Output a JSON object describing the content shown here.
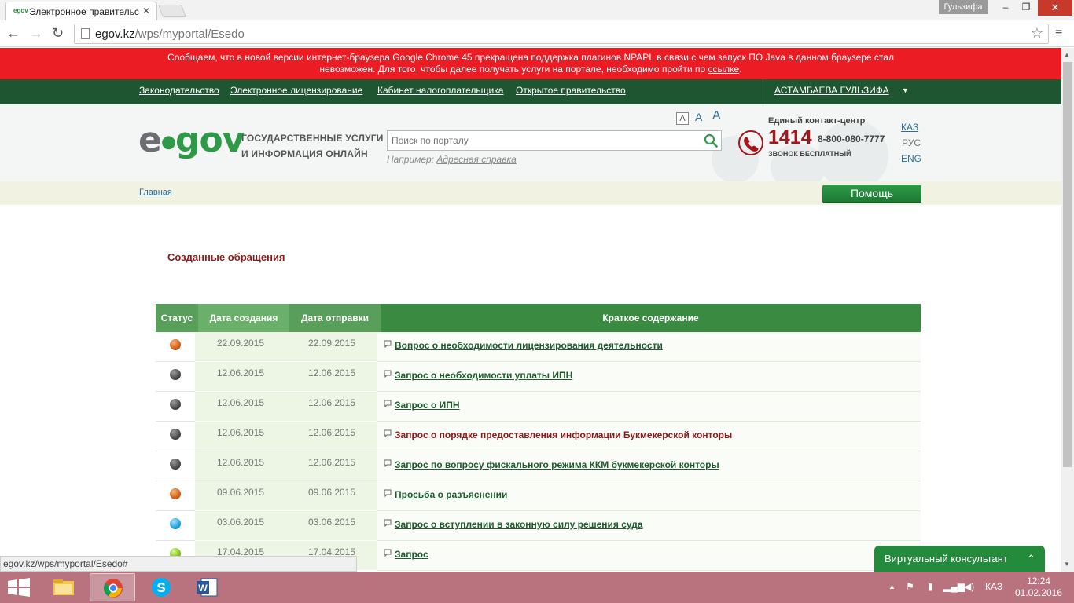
{
  "browser": {
    "tab_title": "Электронное правительс",
    "tab_favicon_text": "egov",
    "tab_close": "✕",
    "user_badge": "Гульзифа",
    "url_host": "egov.kz",
    "url_path": "/wps/myportal/Esedo",
    "status_url": "egov.kz/wps/myportal/Esedo#"
  },
  "notice": {
    "text_part1": "Сообщаем, что в новой версии интернет-браузера Google Chrome 45 прекращена поддержка плагинов NPAPI, в связи с чем запуск ПО Java в данном браузере стал",
    "text_part2": "невозможен. Для того, чтобы далее получать услуги на портале, необходимо пройти по ",
    "link": "ссылке",
    "text_end": "."
  },
  "topnav": {
    "items": [
      "Законодательство",
      "Электронное лицензирование",
      "Кабинет налогоплательщика",
      "Открытое правительство"
    ],
    "user_name": "АСТАМБАЕВА ГУЛЬЗИФА",
    "caret": "▼"
  },
  "header": {
    "logo_e": "e",
    "logo_dot": "●",
    "logo_gov": "gov",
    "tagline_line1": "ГОСУДАРСТВЕННЫЕ УСЛУГИ",
    "tagline_line2": "И ИНФОРМАЦИЯ ОНЛАЙН",
    "search_placeholder": "Поиск по порталу",
    "example_label": "Например: ",
    "example_link": "Адресная справка",
    "font_sizes": [
      "A",
      "A",
      "A"
    ],
    "contact_title": "Единый контакт-центр",
    "contact_number": "1414",
    "contact_phone": "8-800-080-7777",
    "contact_free": "ЗВОНОК БЕСПЛАТНЫЙ",
    "languages": [
      "КАЗ",
      "РУС",
      "ENG"
    ]
  },
  "crumbs": {
    "home": "Главная",
    "help_button": "Помощь"
  },
  "page": {
    "title": "Созданные обращения"
  },
  "table": {
    "headers": {
      "status": "Статус",
      "created": "Дата создания",
      "sent": "Дата отправки",
      "summary": "Краткое содержание"
    },
    "rows": [
      {
        "status": "orange",
        "created": "22.09.2015",
        "sent": "22.09.2015",
        "summary": "Вопрос о необходимости лицензирования деятельности",
        "style": "link"
      },
      {
        "status": "gray",
        "created": "12.06.2015",
        "sent": "12.06.2015",
        "summary": "Запрос о необходимости уплаты ИПН",
        "style": "link"
      },
      {
        "status": "gray",
        "created": "12.06.2015",
        "sent": "12.06.2015",
        "summary": "Запрос о ИПН",
        "style": "link"
      },
      {
        "status": "gray",
        "created": "12.06.2015",
        "sent": "12.06.2015",
        "summary": "Запрос о порядке предоставления информации Букмекерской конторы",
        "style": "red"
      },
      {
        "status": "gray",
        "created": "12.06.2015",
        "sent": "12.06.2015",
        "summary": "Запрос по вопросу фискального режима ККМ букмекерской конторы",
        "style": "link"
      },
      {
        "status": "orange",
        "created": "09.06.2015",
        "sent": "09.06.2015",
        "summary": "Просьба о разъяснении",
        "style": "link"
      },
      {
        "status": "blue",
        "created": "03.06.2015",
        "sent": "03.06.2015",
        "summary": "Запрос о вступлении в законную силу решения суда",
        "style": "link"
      },
      {
        "status": "green",
        "created": "17.04.2015",
        "sent": "17.04.2015",
        "summary": "Запрос",
        "style": "link"
      }
    ]
  },
  "consultant": {
    "label": "Виртуальный консультант",
    "chevron": "⌃"
  },
  "taskbar": {
    "lang": "КАЗ",
    "time": "12:24",
    "date": "01.02.2016"
  },
  "colors": {
    "notice_red": "#ec1c24",
    "nav_green": "#1e5631",
    "accent_green": "#2e9a48",
    "title_red": "#8b1a1a"
  },
  "icons": [
    "back-icon",
    "forward-icon",
    "reload-icon",
    "star-icon",
    "menu-icon",
    "search-icon",
    "phone-icon",
    "bubble-icon",
    "windows-start-icon"
  ]
}
